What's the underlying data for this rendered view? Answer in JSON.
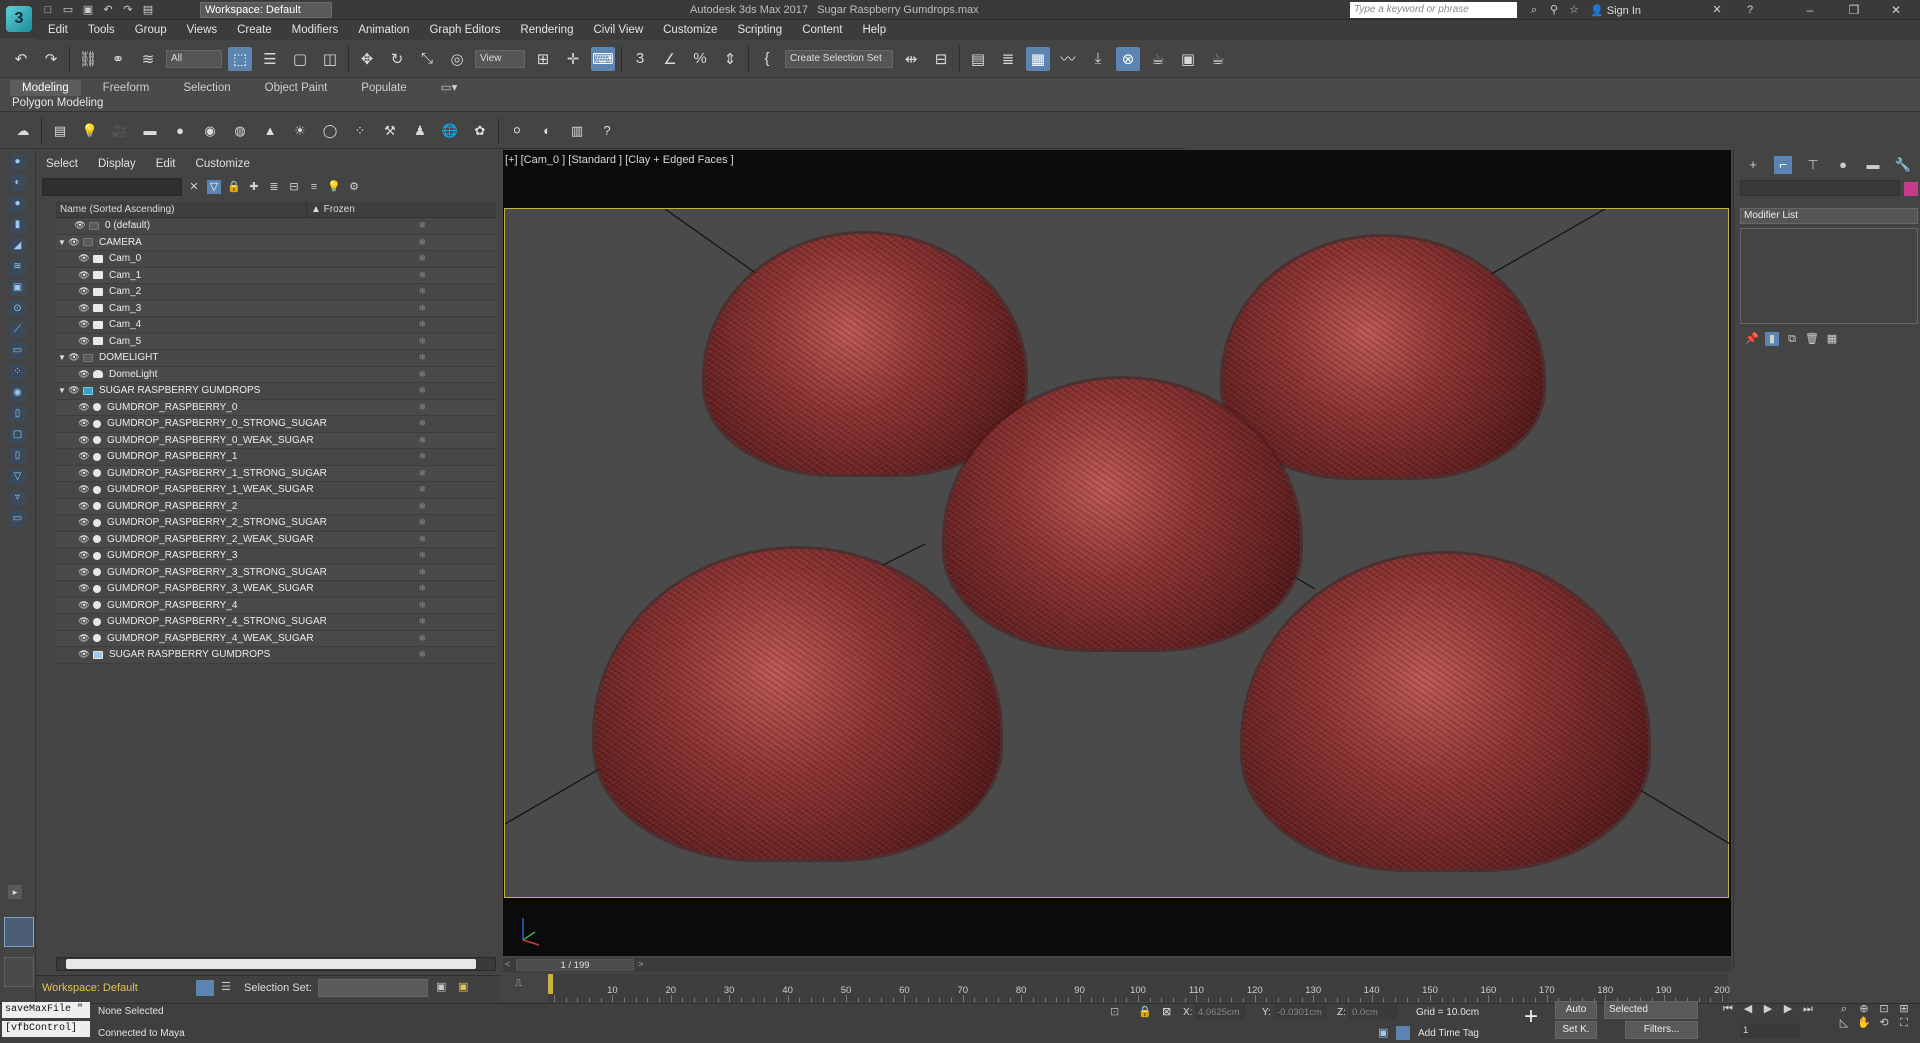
{
  "title_bar": {
    "app_title": "Autodesk 3ds Max 2017",
    "file_title": "Sugar Raspberry Gumdrops.max",
    "workspace": "Workspace: Default",
    "search_placeholder": "Type a keyword or phrase",
    "sign_in": "Sign In"
  },
  "menu": [
    "Edit",
    "Tools",
    "Group",
    "Views",
    "Create",
    "Modifiers",
    "Animation",
    "Graph Editors",
    "Rendering",
    "Civil View",
    "Customize",
    "Scripting",
    "Content",
    "Help"
  ],
  "toolbar": {
    "filter": "All",
    "view": "View",
    "selection_set": "Create Selection Set"
  },
  "ribbon": {
    "tabs": [
      "Modeling",
      "Freeform",
      "Selection",
      "Object Paint",
      "Populate"
    ],
    "active": "Modeling",
    "panel": "Polygon Modeling"
  },
  "explorer": {
    "menu": [
      "Select",
      "Display",
      "Edit",
      "Customize"
    ],
    "col_name": "Name (Sorted Ascending)",
    "col_frozen": "▲ Frozen",
    "rows": [
      {
        "label": "0 (default)",
        "level": 1,
        "group": false,
        "icon": "layer"
      },
      {
        "label": "CAMERA",
        "level": 0,
        "group": true,
        "icon": "layer"
      },
      {
        "label": "Cam_0",
        "level": 2,
        "group": false,
        "icon": "camera"
      },
      {
        "label": "Cam_1",
        "level": 2,
        "group": false,
        "icon": "camera"
      },
      {
        "label": "Cam_2",
        "level": 2,
        "group": false,
        "icon": "camera"
      },
      {
        "label": "Cam_3",
        "level": 2,
        "group": false,
        "icon": "camera"
      },
      {
        "label": "Cam_4",
        "level": 2,
        "group": false,
        "icon": "camera"
      },
      {
        "label": "Cam_5",
        "level": 2,
        "group": false,
        "icon": "camera"
      },
      {
        "label": "DOMELIGHT",
        "level": 0,
        "group": true,
        "icon": "layer"
      },
      {
        "label": "DomeLight",
        "level": 2,
        "group": false,
        "icon": "light"
      },
      {
        "label": "SUGAR RASPBERRY GUMDROPS",
        "level": 0,
        "group": true,
        "icon": "layer-blue"
      },
      {
        "label": "GUMDROP_RASPBERRY_0",
        "level": 2,
        "group": false,
        "icon": "sphere"
      },
      {
        "label": "GUMDROP_RASPBERRY_0_STRONG_SUGAR",
        "level": 2,
        "group": false,
        "icon": "sphere"
      },
      {
        "label": "GUMDROP_RASPBERRY_0_WEAK_SUGAR",
        "level": 2,
        "group": false,
        "icon": "sphere"
      },
      {
        "label": "GUMDROP_RASPBERRY_1",
        "level": 2,
        "group": false,
        "icon": "sphere"
      },
      {
        "label": "GUMDROP_RASPBERRY_1_STRONG_SUGAR",
        "level": 2,
        "group": false,
        "icon": "sphere"
      },
      {
        "label": "GUMDROP_RASPBERRY_1_WEAK_SUGAR",
        "level": 2,
        "group": false,
        "icon": "sphere"
      },
      {
        "label": "GUMDROP_RASPBERRY_2",
        "level": 2,
        "group": false,
        "icon": "sphere"
      },
      {
        "label": "GUMDROP_RASPBERRY_2_STRONG_SUGAR",
        "level": 2,
        "group": false,
        "icon": "sphere"
      },
      {
        "label": "GUMDROP_RASPBERRY_2_WEAK_SUGAR",
        "level": 2,
        "group": false,
        "icon": "sphere"
      },
      {
        "label": "GUMDROP_RASPBERRY_3",
        "level": 2,
        "group": false,
        "icon": "sphere"
      },
      {
        "label": "GUMDROP_RASPBERRY_3_STRONG_SUGAR",
        "level": 2,
        "group": false,
        "icon": "sphere"
      },
      {
        "label": "GUMDROP_RASPBERRY_3_WEAK_SUGAR",
        "level": 2,
        "group": false,
        "icon": "sphere"
      },
      {
        "label": "GUMDROP_RASPBERRY_4",
        "level": 2,
        "group": false,
        "icon": "sphere"
      },
      {
        "label": "GUMDROP_RASPBERRY_4_STRONG_SUGAR",
        "level": 2,
        "group": false,
        "icon": "sphere"
      },
      {
        "label": "GUMDROP_RASPBERRY_4_WEAK_SUGAR",
        "level": 2,
        "group": false,
        "icon": "sphere"
      },
      {
        "label": "SUGAR RASPBERRY GUMDROPS",
        "level": 2,
        "group": false,
        "icon": "group"
      }
    ],
    "workspace": "Workspace: Default",
    "selection_set_label": "Selection Set:"
  },
  "viewport": {
    "label": "[+] [Cam_0 ] [Standard ] [Clay + Edged Faces ]"
  },
  "command_panel": {
    "modifier_list": "Modifier List"
  },
  "timeline": {
    "frame": "1 / 199",
    "ticks": [
      "10",
      "20",
      "30",
      "40",
      "50",
      "60",
      "70",
      "80",
      "90",
      "100",
      "110",
      "120",
      "130",
      "140",
      "150",
      "160",
      "170",
      "180",
      "190",
      "200"
    ]
  },
  "status": {
    "maxscript1": "saveMaxFile \"",
    "maxscript2": "[vfbControl]",
    "selected": "None Selected",
    "connected": "Connected to Maya",
    "x_label": "X:",
    "x_val": "4.0625cm",
    "y_label": "Y:",
    "y_val": "-0.0301cm",
    "z_label": "Z:",
    "z_val": "0.0cm",
    "grid": "Grid = 10.0cm",
    "add_time_tag": "Add Time Tag",
    "auto": "Auto",
    "selected_dd": "Selected",
    "setk": "Set K.",
    "filters": "Filters...",
    "frame_field": "1"
  },
  "colors": {
    "accent": "#5b84b0",
    "gumdrop": "#8c3433",
    "viewport_border": "#c6b342",
    "workspace_text": "#e6c34f"
  }
}
